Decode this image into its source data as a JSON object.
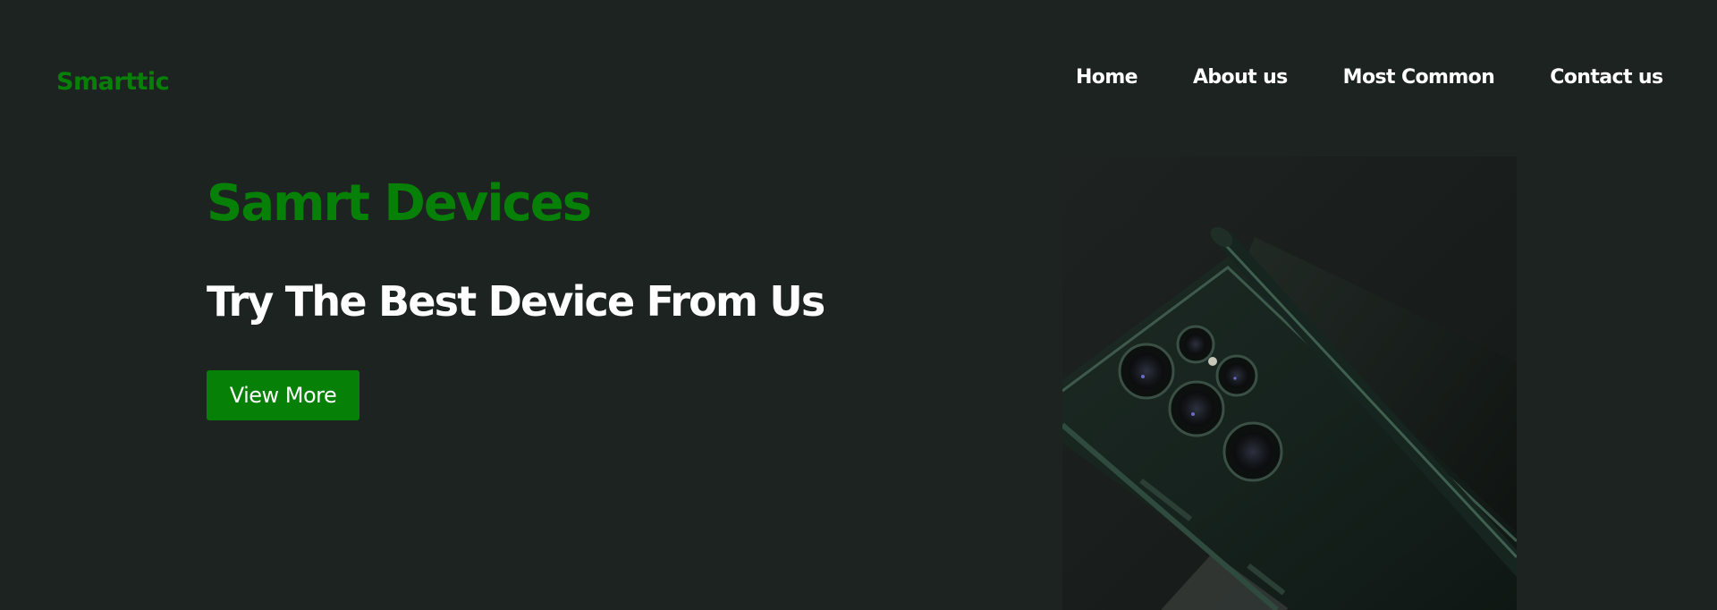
{
  "header": {
    "logo": "Smarttic",
    "nav": [
      {
        "label": "Home"
      },
      {
        "label": "About us"
      },
      {
        "label": "Most Common"
      },
      {
        "label": "Contact us"
      }
    ]
  },
  "hero": {
    "title": "Samrt Devices",
    "subtitle": "Try The Best Device From Us",
    "button_label": "View More",
    "image_subject": "phone-with-stylus"
  },
  "colors": {
    "background": "#1d2320",
    "accent": "#078007",
    "nav_text": "#ffffff"
  }
}
